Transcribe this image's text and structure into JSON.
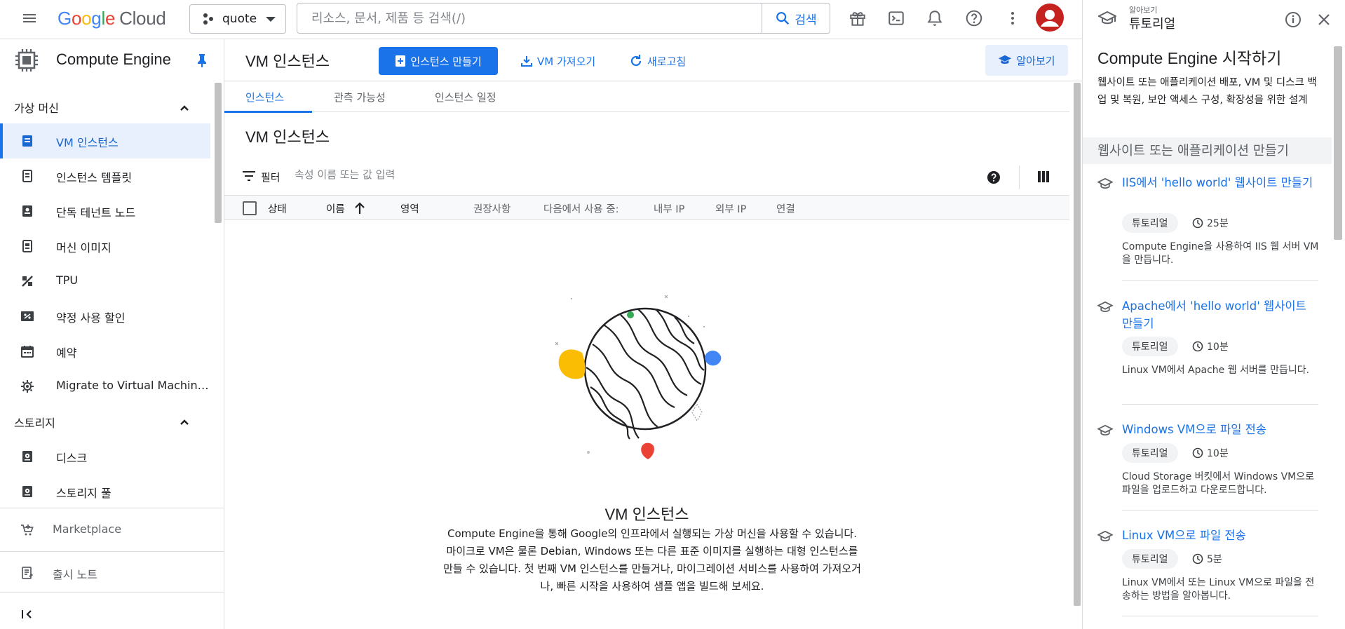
{
  "header": {
    "logo_google": [
      "G",
      "o",
      "o",
      "g",
      "l",
      "e"
    ],
    "logo_cloud": "Cloud",
    "project": "quote",
    "search_placeholder": "리소스, 문서, 제품 등 검색(/)",
    "search_button": "검색",
    "avatar_color": "#c5221f"
  },
  "leftnav": {
    "product": "Compute Engine",
    "sections": [
      {
        "label": "가상 머신"
      },
      {
        "label": "스토리지"
      }
    ],
    "items": [
      {
        "label": "VM 인스턴스",
        "icon": "vm-instance-icon"
      },
      {
        "label": "인스턴스 템플릿",
        "icon": "template-icon"
      },
      {
        "label": "단독 테넌트 노드",
        "icon": "tenant-node-icon"
      },
      {
        "label": "머신 이미지",
        "icon": "machine-image-icon"
      },
      {
        "label": "TPU",
        "icon": "tpu-icon"
      },
      {
        "label": "약정 사용 할인",
        "icon": "discount-icon"
      },
      {
        "label": "예약",
        "icon": "calendar-icon"
      },
      {
        "label": "Migrate to Virtual Machin…",
        "icon": "migrate-icon"
      },
      {
        "label": "디스크",
        "icon": "disk-icon"
      },
      {
        "label": "스토리지 풀",
        "icon": "storage-pool-icon"
      }
    ],
    "marketplace": "Marketplace",
    "release_notes": "출시 노트"
  },
  "main": {
    "title": "VM 인스턴스",
    "create_button": "인스턴스 만들기",
    "import_button": "VM 가져오기",
    "refresh_button": "새로고침",
    "learn_button": "알아보기",
    "tabs": [
      "인스턴스",
      "관측 가능성",
      "인스턴스 일정"
    ],
    "section_title": "VM 인스턴스",
    "filter_label": "필터",
    "filter_placeholder": "속성 이름 또는 값 입력",
    "columns": [
      "상태",
      "이름",
      "영역",
      "권장사항",
      "다음에서 사용 중:",
      "내부 IP",
      "외부 IP",
      "연결"
    ],
    "empty_title": "VM 인스턴스",
    "empty_desc": "Compute Engine을 통해 Google의 인프라에서 실행되는 가상 머신을 사용할 수 있습니다. 마이크로 VM은 물론 Debian, Windows 또는 다른 표준 이미지를 실행하는 대형 인스턴스를 만들 수 있습니다. 첫 번째 VM 인스턴스를 만들거나, 마이그레이션 서비스를 사용하여 가져오거나, 빠른 시작을 사용하여 샘플 앱을 빌드해 보세요."
  },
  "rightpanel": {
    "kicker": "알아보기",
    "heading": "튜토리얼",
    "title": "Compute Engine 시작하기",
    "intro": "웹사이트 또는 애플리케이션 배포, VM 및 디스크 백업 및 복원, 보안 액세스 구성, 확장성을 위한 설계",
    "section": "웹사이트 또는 애플리케이션 만들기",
    "cards": [
      {
        "title": "IIS에서 'hello world' 웹사이트 만들기",
        "chip": "튜토리얼",
        "time": "25분",
        "desc": "Compute Engine을 사용하여 IIS 웹 서버 VM을 만듭니다."
      },
      {
        "title": "Apache에서 'hello world' 웹사이트 만들기",
        "chip": "튜토리얼",
        "time": "10분",
        "desc": "Linux VM에서 Apache 웹 서버를 만듭니다."
      },
      {
        "title": "Windows VM으로 파일 전송",
        "chip": "튜토리얼",
        "time": "10분",
        "desc": "Cloud Storage 버킷에서 Windows VM으로 파일을 업로드하고 다운로드합니다."
      },
      {
        "title": "Linux VM으로 파일 전송",
        "chip": "튜토리얼",
        "time": "5분",
        "desc": "Linux VM에서 또는 Linux VM으로 파일을 전송하는 방법을 알아봅니다."
      }
    ]
  },
  "colors": {
    "accent": "#1a73e8",
    "accent_bg": "#e8f0fe",
    "illus_yellow": "#fbbc04",
    "illus_blue": "#4285f4",
    "illus_red": "#ea4335",
    "illus_green": "#34a853"
  }
}
